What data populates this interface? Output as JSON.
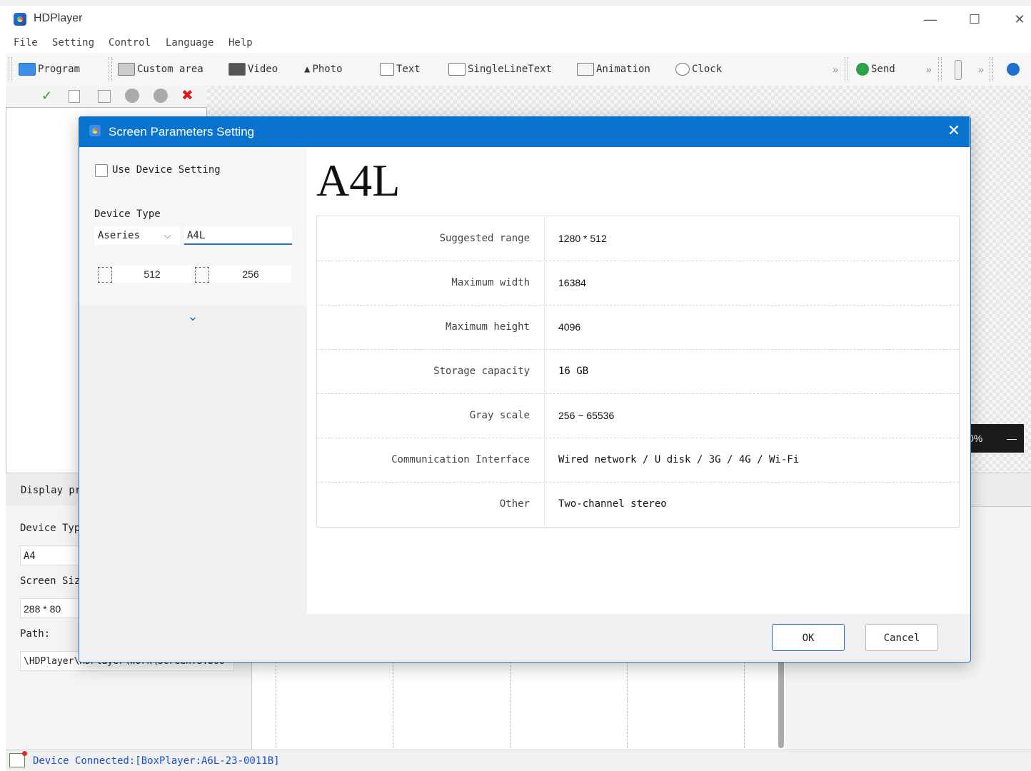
{
  "app": {
    "title": "HDPlayer"
  },
  "window_controls": {
    "minimize": "—",
    "maximize": "☐",
    "close": "✕"
  },
  "menu": [
    "File",
    "Setting",
    "Control",
    "Language",
    "Help"
  ],
  "toolbar": {
    "program": "Program",
    "custom_area": "Custom area",
    "video": "Video",
    "photo": "Photo",
    "text": "Text",
    "single_line_text": "SingleLineText",
    "animation": "Animation",
    "clock": "Clock",
    "more": "»",
    "send": "Send"
  },
  "left_tools": {
    "check": "✓",
    "delete": "✖"
  },
  "zoom": {
    "value": "0%",
    "minus": "—"
  },
  "properties": {
    "header": "Display pr",
    "device_type_label": "Device Typ",
    "device_type_value": "A4",
    "screen_size_label": "Screen Siz",
    "screen_size_value": "288 * 80",
    "path_label": "Path:",
    "path_value": "\\HDPlayer\\HDPlayer\\Work\\ScreenTS.boo"
  },
  "status": {
    "text": "Device Connected:[BoxPlayer:A6L-23-0011B]"
  },
  "dialog": {
    "title": "Screen Parameters Setting",
    "close": "✕",
    "use_device_setting": "Use Device Setting",
    "device_type_label": "Device Type",
    "series": "Aseries",
    "model": "A4L",
    "width": "512",
    "height": "256",
    "expand": "⌄",
    "big_model": "A4L",
    "specs": [
      {
        "key": "Suggested range",
        "value": "1280 * 512"
      },
      {
        "key": "Maximum width",
        "value": "16384"
      },
      {
        "key": "Maximum height",
        "value": "4096"
      },
      {
        "key": "Storage capacity",
        "value": "16 GB"
      },
      {
        "key": "Gray scale",
        "value": "256 ~ 65536"
      },
      {
        "key": "Communication Interface",
        "value": "Wired network / U disk / 3G / 4G / Wi-Fi"
      },
      {
        "key": "Other",
        "value": "Two-channel stereo"
      }
    ],
    "ok": "OK",
    "cancel": "Cancel"
  },
  "colors": {
    "accent": "#0a73d0",
    "status_text": "#1a4fd0"
  }
}
